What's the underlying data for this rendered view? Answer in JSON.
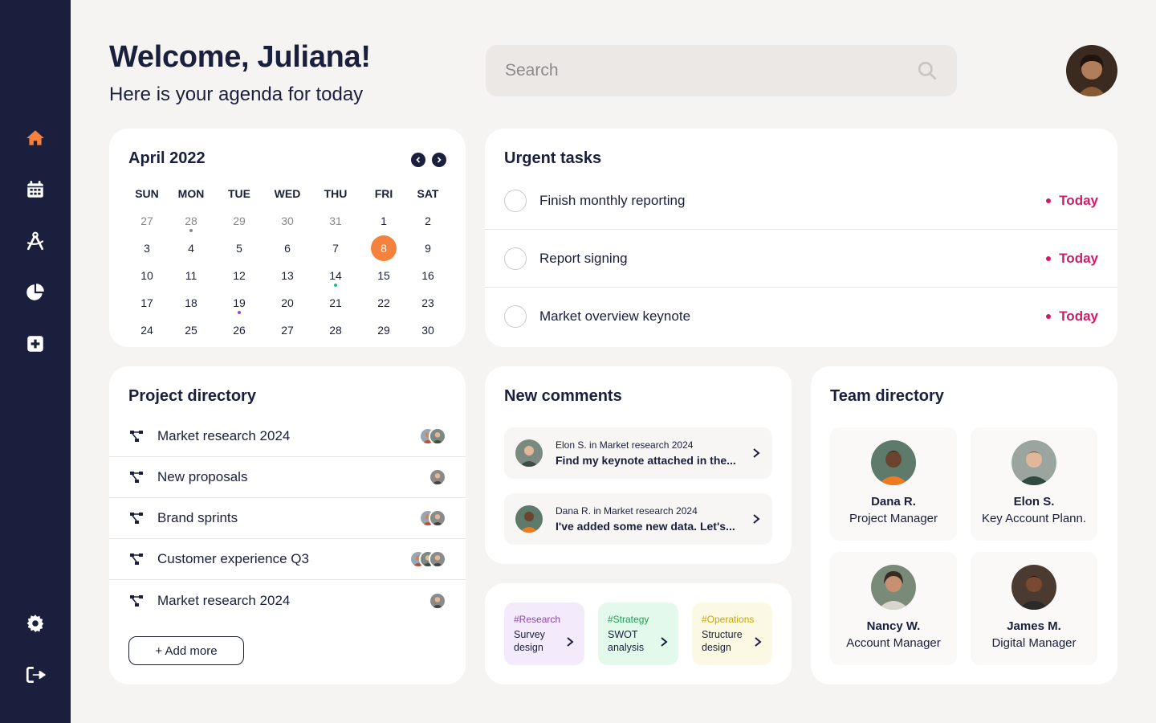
{
  "greeting": {
    "title": "Welcome, Juliana!",
    "subtitle": "Here is your agenda for today"
  },
  "search": {
    "placeholder": "Search"
  },
  "sidebar": {
    "items": [
      {
        "icon": "home-icon",
        "active": true
      },
      {
        "icon": "calendar-icon"
      },
      {
        "icon": "compass-icon"
      },
      {
        "icon": "pie-chart-icon"
      },
      {
        "icon": "plus-square-icon"
      }
    ],
    "bottom": [
      {
        "icon": "settings-icon"
      },
      {
        "icon": "logout-icon"
      }
    ]
  },
  "calendar": {
    "month_label": "April 2022",
    "weekdays": [
      "SUN",
      "MON",
      "TUE",
      "WED",
      "THU",
      "FRI",
      "SAT"
    ],
    "weeks": [
      [
        "27",
        "28",
        "29",
        "30",
        "31",
        "1",
        "2"
      ],
      [
        "3",
        "4",
        "5",
        "6",
        "7",
        "8",
        "9"
      ],
      [
        "10",
        "11",
        "12",
        "13",
        "14",
        "15",
        "16"
      ],
      [
        "17",
        "18",
        "19",
        "20",
        "21",
        "22",
        "23"
      ],
      [
        "24",
        "25",
        "26",
        "27",
        "28",
        "29",
        "30"
      ]
    ],
    "selected_day": "8"
  },
  "urgent": {
    "title": "Urgent tasks",
    "tasks": [
      {
        "label": "Finish monthly reporting",
        "due": "Today"
      },
      {
        "label": "Report signing",
        "due": "Today"
      },
      {
        "label": "Market overview keynote",
        "due": "Today"
      }
    ]
  },
  "projects": {
    "title": "Project directory",
    "items": [
      {
        "label": "Market research 2024"
      },
      {
        "label": "New proposals"
      },
      {
        "label": "Brand sprints"
      },
      {
        "label": "Customer experience Q3"
      },
      {
        "label": "Market research 2024"
      }
    ],
    "add_label": "+ Add more"
  },
  "comments": {
    "title": "New comments",
    "items": [
      {
        "meta": "Elon S. in Market research 2024",
        "text": "Find my keynote attached in the..."
      },
      {
        "meta": "Dana R. in Market research 2024",
        "text": "I've added some new data. Let's..."
      }
    ]
  },
  "tags": [
    {
      "tag": "#Research",
      "title": "Survey design",
      "color": "#8e44ad",
      "bg": "#f3ebfc"
    },
    {
      "tag": "#Strategy",
      "title": "SWOT analysis",
      "color": "#1f9d55",
      "bg": "#e3f9ec"
    },
    {
      "tag": "#Operations",
      "title": "Structure design",
      "color": "#c9a500",
      "bg": "#fbf9e4"
    }
  ],
  "team": {
    "title": "Team directory",
    "members": [
      {
        "name": "Dana R.",
        "role": "Project Manager"
      },
      {
        "name": "Elon S.",
        "role": "Key Account Plann."
      },
      {
        "name": "Nancy W.",
        "role": "Account Manager"
      },
      {
        "name": "James M.",
        "role": "Digital Manager"
      }
    ]
  },
  "colors": {
    "sidebar": "#1a1f3d",
    "accent": "#f5813f",
    "urgent": "#d4196a"
  }
}
